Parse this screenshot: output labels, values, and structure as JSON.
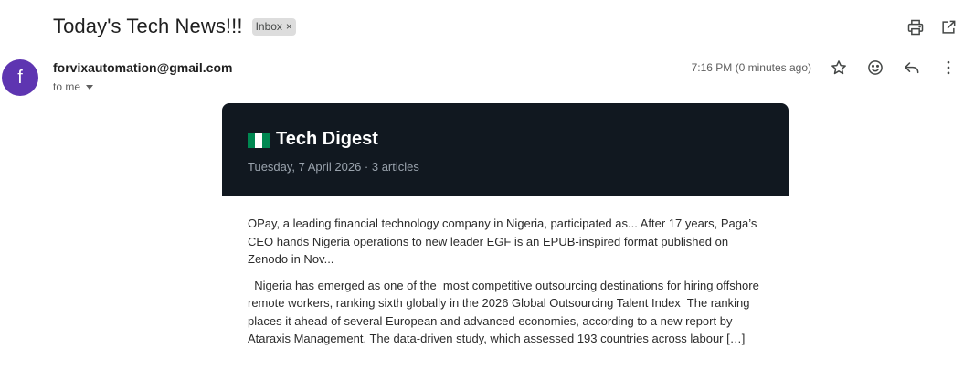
{
  "email": {
    "subject": "Today's Tech News!!!",
    "label": "Inbox",
    "label_close": "×",
    "sender": "forvixautomation@gmail.com",
    "avatar_letter": "f",
    "recipient": "to me",
    "timestamp": "7:16 PM (0 minutes ago)",
    "actions": [
      "print-icon",
      "open-in-new-window-icon",
      "star-icon",
      "emoji-icon",
      "reply-icon",
      "more-vert-icon"
    ]
  },
  "digest": {
    "title": "Tech Digest",
    "flag_icon": "nigeria-flag-icon",
    "subtitle": "Tuesday, 7 April 2026 · 3 articles",
    "header_color": "#111820",
    "paragraphs": [
      "OPay, a leading financial technology company in Nigeria, participated as... After 17 years, Paga’s CEO hands Nigeria operations to new leader EGF is an EPUB-inspired format published on Zenodo in Nov...",
      "  Nigeria has emerged as one of the  most competitive outsourcing destinations for hiring offshore remote workers, ranking sixth globally in the 2026 Global Outsourcing Talent Index  The ranking places it ahead of several European and advanced economies, according to a new report by Ataraxis Management. The data-driven study, which assessed 193 countries across labour […]"
    ]
  },
  "colors": {
    "avatar": "#5e35b1",
    "flag_green": "#008751",
    "flag_white": "#ffffff"
  }
}
